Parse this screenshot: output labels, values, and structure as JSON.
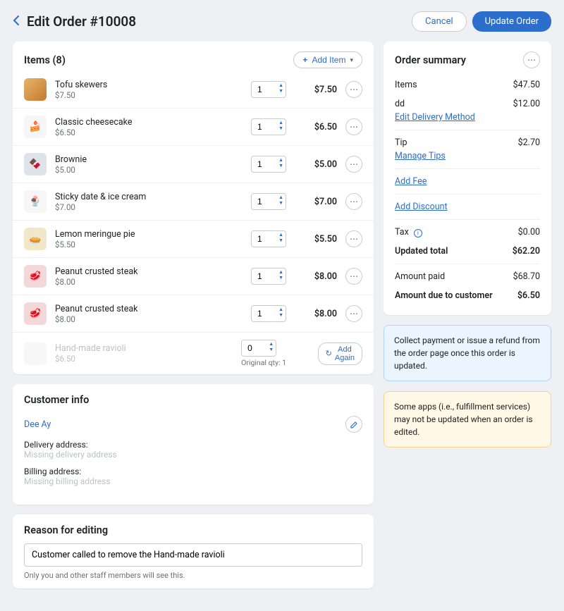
{
  "header": {
    "title": "Edit Order #10008",
    "cancel_label": "Cancel",
    "update_label": "Update Order"
  },
  "items_card": {
    "title": "Items (8)",
    "add_item_label": "Add Item",
    "items": [
      {
        "name": "Tofu skewers",
        "price": "$7.50",
        "qty": "1",
        "total": "$7.50"
      },
      {
        "name": "Classic cheesecake",
        "price": "$6.50",
        "qty": "1",
        "total": "$6.50"
      },
      {
        "name": "Brownie",
        "price": "$5.00",
        "qty": "1",
        "total": "$5.00"
      },
      {
        "name": "Sticky date & ice cream",
        "price": "$7.00",
        "qty": "1",
        "total": "$7.00"
      },
      {
        "name": "Lemon meringue pie",
        "price": "$5.50",
        "qty": "1",
        "total": "$5.50"
      },
      {
        "name": "Peanut crusted steak",
        "price": "$8.00",
        "qty": "1",
        "total": "$8.00"
      },
      {
        "name": "Peanut crusted steak",
        "price": "$8.00",
        "qty": "1",
        "total": "$8.00"
      }
    ],
    "removed_item": {
      "name": "Hand-made ravioli",
      "price": "$6.50",
      "qty": "0",
      "original_qty_label": "Original qty: 1",
      "add_again_label": "Add Again"
    }
  },
  "customer": {
    "title": "Customer info",
    "name": "Dee Ay",
    "delivery_label": "Delivery address:",
    "delivery_value": "Missing delivery address",
    "billing_label": "Billing address:",
    "billing_value": "Missing billing address"
  },
  "reason": {
    "title": "Reason for editing",
    "value": "Customer called to remove the Hand-made ravioli",
    "note": "Only you and other staff members will see this."
  },
  "summary": {
    "title": "Order summary",
    "items_label": "Items",
    "items_value": "$47.50",
    "dd_label": "dd",
    "dd_value": "$12.00",
    "edit_delivery_label": "Edit Delivery Method",
    "tip_label": "Tip",
    "tip_value": "$2.70",
    "manage_tips_label": "Manage Tips",
    "add_fee_label": "Add Fee",
    "add_discount_label": "Add Discount",
    "tax_label": "Tax",
    "tax_value": "$0.00",
    "updated_total_label": "Updated total",
    "updated_total_value": "$62.20",
    "amount_paid_label": "Amount paid",
    "amount_paid_value": "$68.70",
    "amount_due_label": "Amount due to customer",
    "amount_due_value": "$6.50"
  },
  "banners": {
    "info": "Collect payment or issue a refund from the order page once this order is updated.",
    "warn": "Some apps (i.e., fulfillment services) may not be updated when an order is edited."
  }
}
